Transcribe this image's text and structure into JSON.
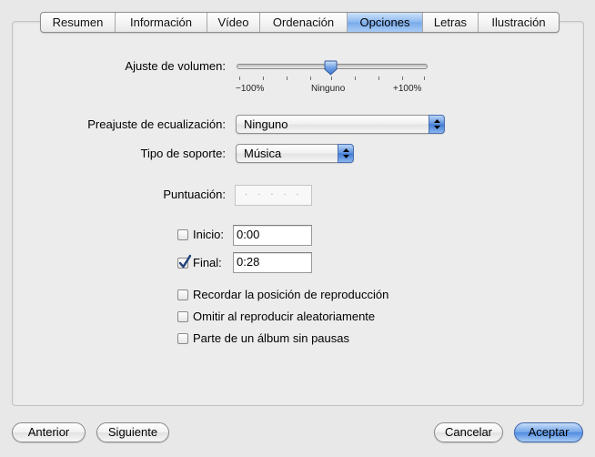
{
  "tabs": [
    {
      "label": "Resumen",
      "active": false
    },
    {
      "label": "Información",
      "active": false
    },
    {
      "label": "Vídeo",
      "active": false
    },
    {
      "label": "Ordenación",
      "active": false
    },
    {
      "label": "Opciones",
      "active": true
    },
    {
      "label": "Letras",
      "active": false
    },
    {
      "label": "Ilustración",
      "active": false
    }
  ],
  "volume": {
    "label": "Ajuste de volumen:",
    "min_label": "−100%",
    "mid_label": "Ninguno",
    "max_label": "+100%",
    "value_percent": 0
  },
  "equalizer": {
    "label": "Preajuste de ecualización:",
    "value": "Ninguno"
  },
  "media_kind": {
    "label": "Tipo de soporte:",
    "value": "Música"
  },
  "rating": {
    "label": "Puntuación:",
    "value": "· · · · ·"
  },
  "start": {
    "label": "Inicio:",
    "checked": false,
    "value": "0:00"
  },
  "stop": {
    "label": "Final:",
    "checked": true,
    "value": "0:28"
  },
  "options": {
    "remember": {
      "label": "Recordar la posición de reproducción",
      "checked": false
    },
    "skip_shuffle": {
      "label": "Omitir al reproducir aleatoriamente",
      "checked": false
    },
    "gapless": {
      "label": "Parte de un álbum sin pausas",
      "checked": false
    }
  },
  "buttons": {
    "previous": "Anterior",
    "next": "Siguiente",
    "cancel": "Cancelar",
    "ok": "Aceptar"
  },
  "colors": {
    "accent": "#5b8fdc",
    "background": "#e8e8e8"
  }
}
